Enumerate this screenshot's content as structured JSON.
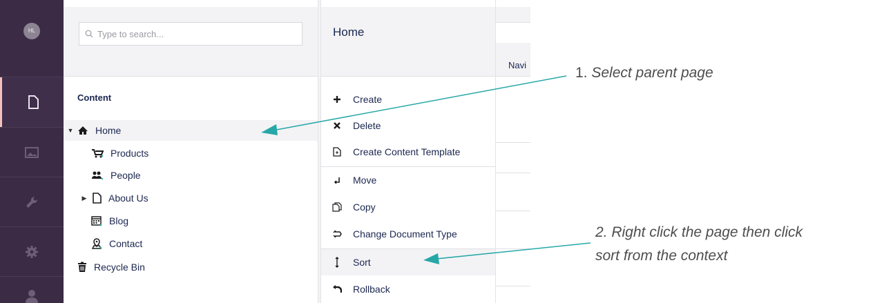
{
  "rail": {
    "avatar_initials": "HL",
    "items": [
      {
        "icon": "document-icon",
        "active": true
      },
      {
        "icon": "image-icon",
        "active": false
      },
      {
        "icon": "wrench-icon",
        "active": false
      },
      {
        "icon": "gear-icon",
        "active": false
      },
      {
        "icon": "user-icon",
        "active": false
      }
    ]
  },
  "tree": {
    "search_placeholder": "Type to search...",
    "section_title": "Content",
    "items": [
      {
        "label": "Home",
        "icon": "home-icon",
        "selected": true,
        "expanded": true
      },
      {
        "label": "Products",
        "icon": "cart-icon"
      },
      {
        "label": "People",
        "icon": "people-icon"
      },
      {
        "label": "About Us",
        "icon": "document-icon",
        "collapsed": true
      },
      {
        "label": "Blog",
        "icon": "calendar-icon"
      },
      {
        "label": "Contact",
        "icon": "map-pin-icon"
      },
      {
        "label": "Recycle Bin",
        "icon": "trash-icon"
      }
    ]
  },
  "menu": {
    "title": "Home",
    "items": [
      {
        "label": "Create",
        "icon": "plus-icon"
      },
      {
        "label": "Delete",
        "icon": "x-icon"
      },
      {
        "label": "Create Content Template",
        "icon": "template-icon"
      },
      {
        "label": "Move",
        "icon": "move-icon"
      },
      {
        "label": "Copy",
        "icon": "copy-icon"
      },
      {
        "label": "Change Document Type",
        "icon": "change-type-icon"
      },
      {
        "label": "Sort",
        "icon": "sort-icon",
        "highlighted": true
      },
      {
        "label": "Rollback",
        "icon": "rollback-icon"
      }
    ]
  },
  "content": {
    "tab_label": "Navi"
  },
  "annotations": {
    "step1_number": "1. ",
    "step1_text": "Select parent page",
    "step2_line1": "2. Right click the page then click",
    "step2_line2": "sort from the context",
    "arrow_color": "#27a7a7"
  }
}
